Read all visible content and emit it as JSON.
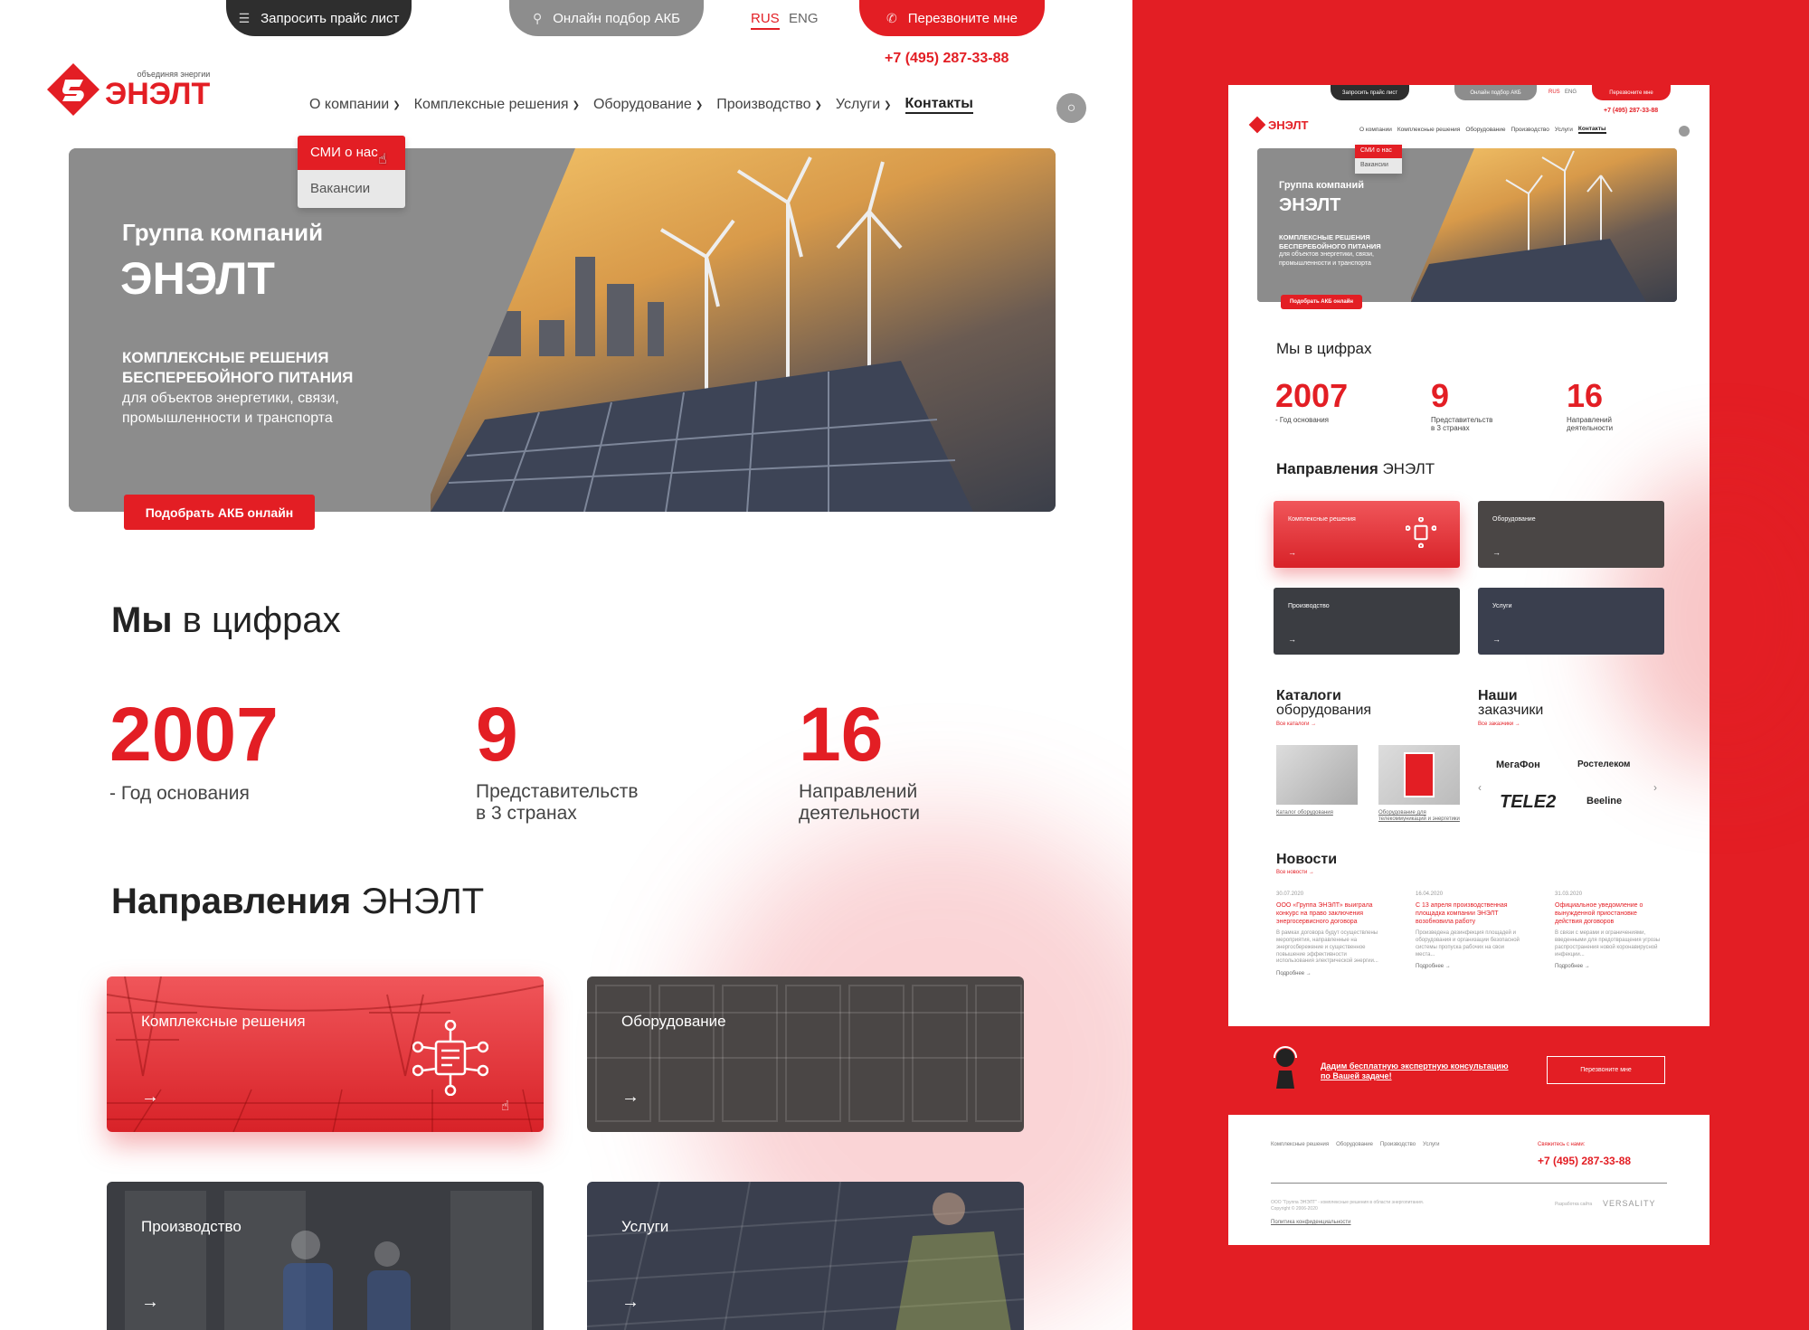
{
  "topbar": {
    "price_request": "Запросить прайс лист",
    "akb_online": "Онлайн подбор АКБ",
    "lang_rus": "RUS",
    "lang_eng": "ENG",
    "callback": "Перезвоните мне",
    "phone": "+7 (495) 287-33-88"
  },
  "logo": {
    "name": "ЭНЭЛТ",
    "tagline": "объединяя энергии"
  },
  "nav": {
    "items": [
      "О компании",
      "Комплексные решения",
      "Оборудование",
      "Производство",
      "Услуги",
      "Контакты"
    ],
    "dropdown": [
      "СМИ о нас",
      "Вакансии"
    ]
  },
  "hero": {
    "line1": "Группа компаний",
    "line2": "ЭНЭЛТ",
    "bold1": "КОМПЛЕКСНЫЕ РЕШЕНИЯ",
    "bold2": "БЕСПЕРЕБОЙНОГО ПИТАНИЯ",
    "sub1": "для объектов энергетики, связи,",
    "sub2": "промышленности и транспорта",
    "button": "Подобрать АКБ онлайн"
  },
  "numbers": {
    "title_bold": "Мы",
    "title_rest": " в цифрах",
    "stats": [
      {
        "value": "2007",
        "cap1": "- Год основания",
        "cap2": ""
      },
      {
        "value": "9",
        "cap1": "Представительств",
        "cap2": "в 3 странах"
      },
      {
        "value": "16",
        "cap1": "Направлений",
        "cap2": "деятельности"
      }
    ]
  },
  "directions": {
    "title_bold": "Направления",
    "title_rest": " ЭНЭЛТ",
    "cards": [
      "Комплексные решения",
      "Оборудование",
      "Производство",
      "Услуги"
    ],
    "arrow": "→"
  },
  "mini": {
    "numbers_title": "Мы в цифрах",
    "catalogs_title1": "Каталоги",
    "catalogs_title2": "оборудования",
    "catalogs_link": "Все каталоги →",
    "catalog_items": [
      "Каталог оборудования",
      "Оборудование для телекоммуникаций и энергетики"
    ],
    "clients_title1": "Наши",
    "clients_title2": "заказчики",
    "clients_link": "Все заказчики →",
    "clients": [
      "МегаФон",
      "Ростелеком",
      "TELE2",
      "Beeline"
    ],
    "news_title": "Новости",
    "news_link": "Все новости →",
    "news": [
      {
        "date": "30.07.2020",
        "title": "ООО «Группа ЭНЭЛТ» выиграла конкурс на право заключения энергосервисного договора",
        "body": "В рамках договора будут осуществлены мероприятия, направленные на энергосбережение и существенное повышение эффективности использования электрической энергии...",
        "more": "Подробнее →"
      },
      {
        "date": "16.04.2020",
        "title": "С 13 апреля производственная площадка компании ЭНЭЛТ возобновила работу",
        "body": "Произведена дезинфекция площадей и оборудования и организации безопасной системы пропуска рабочих на свои места...",
        "more": "Подробнее →"
      },
      {
        "date": "31.03.2020",
        "title": "Официальное уведомление о вынужденной приостановке действия договоров",
        "body": "В связи с мерами и ограничениями, введенными для предотвращения угрозы распространения новой коронавирусной инфекции...",
        "more": "Подробнее →"
      }
    ],
    "consult1": "Дадим бесплатную экспертную консультацию",
    "consult2": "по Вашей задаче!",
    "consult_btn": "Перезвоните мне",
    "footer_links": [
      "Комплексные решения",
      "Оборудование",
      "Производство",
      "Услуги"
    ],
    "contact_label": "Свяжитесь с нами:",
    "footer_copy1": "ООО \"Группа ЭНЭЛТ\" - комплексные решения в области энергопитания.",
    "footer_copy2": "Copyright © 2006-2020",
    "footer_dev": "Разработка сайта",
    "footer_dev_name": "VERSALITY",
    "privacy": "Политика конфиденциальности"
  },
  "colors": {
    "brand_red": "#e31e24",
    "dark": "#2b2b2b",
    "gray": "#8c8c8c"
  }
}
